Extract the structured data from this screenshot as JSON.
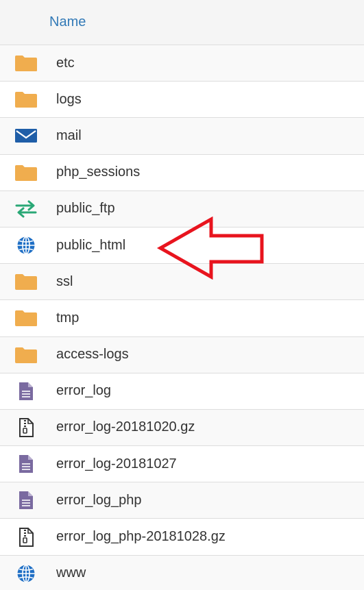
{
  "header": {
    "name_label": "Name"
  },
  "colors": {
    "folder": "#f0ad4e",
    "mail": "#1f5ea8",
    "ftp": "#2aa876",
    "globe": "#1f6fc5",
    "file": "#7a6aa0",
    "archive": "#333333",
    "annotation_arrow": "#e8141e",
    "header_link": "#337ab7"
  },
  "files": [
    {
      "name": "etc",
      "icon": "folder-icon"
    },
    {
      "name": "logs",
      "icon": "folder-icon"
    },
    {
      "name": "mail",
      "icon": "envelope-icon"
    },
    {
      "name": "php_sessions",
      "icon": "folder-icon"
    },
    {
      "name": "public_ftp",
      "icon": "transfer-arrows-icon"
    },
    {
      "name": "public_html",
      "icon": "globe-icon"
    },
    {
      "name": "ssl",
      "icon": "folder-icon"
    },
    {
      "name": "tmp",
      "icon": "folder-icon"
    },
    {
      "name": "access-logs",
      "icon": "folder-icon"
    },
    {
      "name": "error_log",
      "icon": "file-text-icon"
    },
    {
      "name": "error_log-20181020.gz",
      "icon": "file-archive-icon"
    },
    {
      "name": "error_log-20181027",
      "icon": "file-text-icon"
    },
    {
      "name": "error_log_php",
      "icon": "file-text-icon"
    },
    {
      "name": "error_log_php-20181028.gz",
      "icon": "file-archive-icon"
    },
    {
      "name": "www",
      "icon": "globe-icon"
    }
  ]
}
